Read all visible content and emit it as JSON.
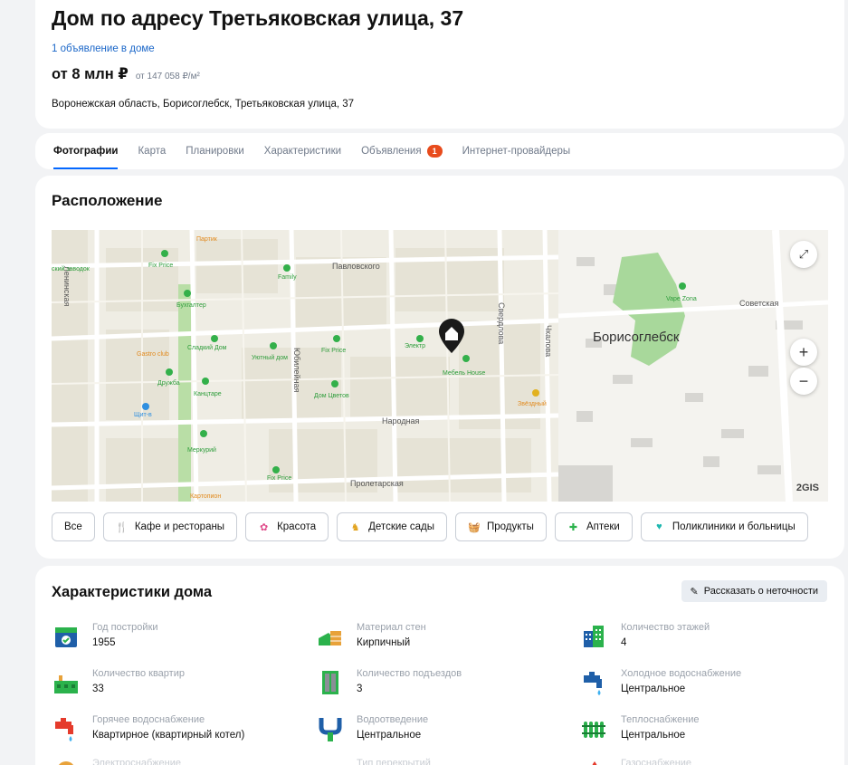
{
  "header": {
    "title": "Дом по адресу Третьяковская улица, 37",
    "ads_link": "1 объявление в доме",
    "price": "от 8 млн ₽",
    "price_per_m2": "от 147 058 ₽/м²",
    "address": "Воронежская область, Борисоглебск, Третьяковская улица, 37"
  },
  "tabs": [
    {
      "label": "Фотографии",
      "active": true
    },
    {
      "label": "Карта"
    },
    {
      "label": "Планировки"
    },
    {
      "label": "Характеристики"
    },
    {
      "label": "Объявления",
      "badge": "1"
    },
    {
      "label": "Интернет-провайдеры"
    }
  ],
  "location": {
    "title": "Расположение",
    "map": {
      "city_label": "Борисоглебск",
      "logo": "2GIS",
      "zoom_in": "+",
      "zoom_out": "−",
      "streets": [
        "Павловского",
        "Народная",
        "Пролетарская",
        "Юбилейная",
        "Свердлова",
        "Чкалова",
        "Советская",
        "Ленинская"
      ],
      "pois": [
        "Fix Price",
        "Family",
        "Бухгалтер",
        "Gastro club",
        "Сладкий Дом",
        "Дружба",
        "Уютный дом",
        "Fix Price",
        "Электр",
        "Мебель House",
        "Канцтаре",
        "Дом Цветов",
        "Щит-в",
        "Меркурий",
        "Fix Price",
        "Картопион",
        "Vape Zona",
        "Звёздный",
        "Партик",
        "Fix Price",
        "ский заводок"
      ]
    },
    "filters": [
      {
        "label": "Все",
        "icon": ""
      },
      {
        "label": "Кафе и рестораны",
        "icon": "fork-knife-icon"
      },
      {
        "label": "Красота",
        "icon": "flower-icon"
      },
      {
        "label": "Детские сады",
        "icon": "rocking-horse-icon"
      },
      {
        "label": "Продукты",
        "icon": "basket-icon"
      },
      {
        "label": "Аптеки",
        "icon": "pharmacy-icon"
      },
      {
        "label": "Поликлиники и больницы",
        "icon": "heart-pulse-icon"
      }
    ]
  },
  "characteristics": {
    "title": "Характеристики дома",
    "report_button": "Рассказать о неточности",
    "items": [
      {
        "label": "Год постройки",
        "value": "1955",
        "icon": "calendar-icon"
      },
      {
        "label": "Материал стен",
        "value": "Кирпичный",
        "icon": "bricks-icon"
      },
      {
        "label": "Количество этажей",
        "value": "4",
        "icon": "buildings-icon"
      },
      {
        "label": "Количество квартир",
        "value": "33",
        "icon": "apartments-icon"
      },
      {
        "label": "Количество подъездов",
        "value": "3",
        "icon": "door-icon"
      },
      {
        "label": "Холодное водоснабжение",
        "value": "Центральное",
        "icon": "cold-tap-icon"
      },
      {
        "label": "Горячее водоснабжение",
        "value": "Квартирное (квартирный котел)",
        "icon": "hot-tap-icon"
      },
      {
        "label": "Водоотведение",
        "value": "Центральное",
        "icon": "pipe-icon"
      },
      {
        "label": "Теплоснабжение",
        "value": "Центральное",
        "icon": "radiator-icon"
      }
    ],
    "partial_labels": [
      "Электроснабжение",
      "Тип перекрытий",
      "Газоснабжение"
    ]
  },
  "colors": {
    "accent": "#0468ff",
    "badge": "#e84b1c",
    "icon_green": "#2bb24c",
    "icon_blue": "#1f5fa8",
    "icon_red": "#e53b2c",
    "park": "#a8d89b"
  }
}
